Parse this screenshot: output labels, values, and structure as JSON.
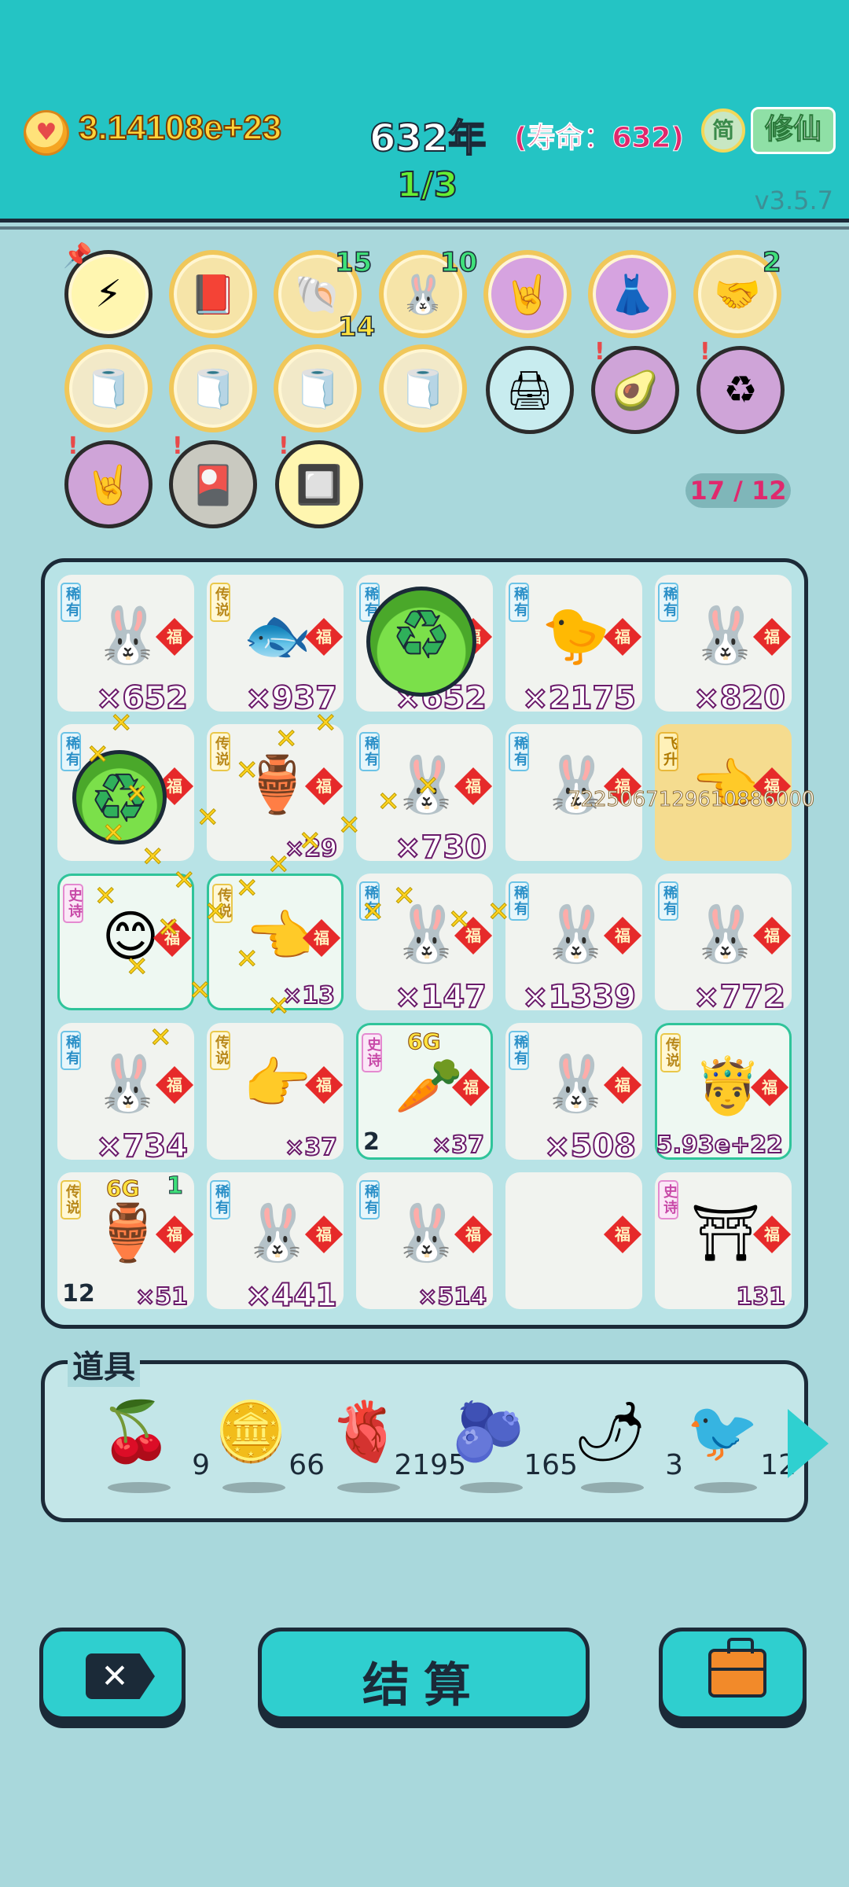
{
  "header": {
    "coins": "3.14108e+23",
    "year": "632年",
    "lifespan": "(寿命：632)",
    "simp_label": "简",
    "xiu_label": "修仙",
    "progress": "1/3",
    "version": "v3.5.7"
  },
  "buffs": {
    "counter": "17 / 12",
    "shell_top": "15",
    "shell_bottom": "14",
    "bunny_count": "10",
    "handshake_count": "2"
  },
  "board": {
    "rows": [
      [
        {
          "tag": "稀有",
          "count": "×652"
        },
        {
          "tag": "传说",
          "count": "×937"
        },
        {
          "tag": "稀有",
          "count": "×652"
        },
        {
          "tag": "稀有",
          "count": "×2175"
        },
        {
          "tag": "稀有",
          "count": "×820"
        }
      ],
      [
        {
          "tag": "稀有",
          "count": ""
        },
        {
          "tag": "传说",
          "count": "×29"
        },
        {
          "tag": "稀有",
          "count": "×730"
        },
        {
          "tag": "稀有",
          "count": "7225067129610886000"
        },
        {
          "tag": "飞升",
          "count": ""
        }
      ],
      [
        {
          "tag": "史诗",
          "count": ""
        },
        {
          "tag": "传说",
          "count": "×13"
        },
        {
          "tag": "稀有",
          "count": "×147"
        },
        {
          "tag": "稀有",
          "count": "×1339"
        },
        {
          "tag": "稀有",
          "count": "×772"
        }
      ],
      [
        {
          "tag": "稀有",
          "count": "×734"
        },
        {
          "tag": "传说",
          "count": "×37"
        },
        {
          "tag": "史诗",
          "count": "×37",
          "level": "2",
          "crown": "6G"
        },
        {
          "tag": "稀有",
          "count": "×508"
        },
        {
          "tag": "传说",
          "count": "5.93e+22"
        }
      ],
      [
        {
          "tag": "传说",
          "count": "×51",
          "level": "12",
          "crown": "6G",
          "badge": "1"
        },
        {
          "tag": "稀有",
          "count": "×441"
        },
        {
          "tag": "稀有",
          "count": "×514"
        },
        {
          "tag": "",
          "count": ""
        },
        {
          "tag": "史诗",
          "count": "131"
        }
      ]
    ],
    "fu": "福"
  },
  "items": {
    "title": "道具",
    "list": [
      {
        "name": "lychee",
        "qty": "9"
      },
      {
        "name": "coin",
        "qty": "66"
      },
      {
        "name": "liver",
        "qty": "2195"
      },
      {
        "name": "blueberry",
        "qty": "165"
      },
      {
        "name": "chili",
        "qty": "3"
      },
      {
        "name": "bird",
        "qty": "12"
      }
    ]
  },
  "footer": {
    "settle_label": "结算"
  }
}
